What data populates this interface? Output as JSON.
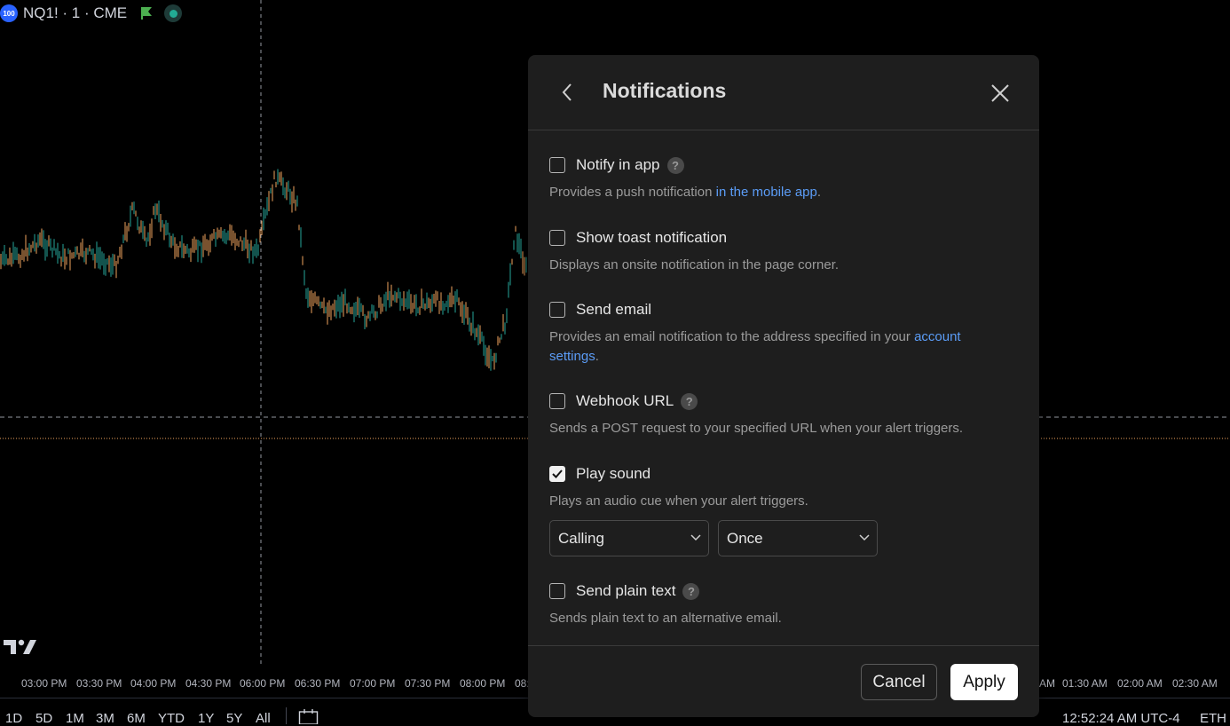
{
  "symbol": {
    "badge": "100",
    "text": "NQ1! · 1 · CME"
  },
  "time_axis": [
    "03:00 PM",
    "03:30 PM",
    "04:00 PM",
    "04:30 PM",
    "06:00 PM",
    "06:30 PM",
    "07:00 PM",
    "07:30 PM",
    "08:00 PM",
    "08:",
    "AM",
    "01:30 AM",
    "02:00 AM",
    "02:30 AM"
  ],
  "ranges": [
    "1D",
    "5D",
    "1M",
    "3M",
    "6M",
    "YTD",
    "1Y",
    "5Y",
    "All"
  ],
  "clock": "12:52:24 AM UTC-4",
  "session": "ETH",
  "dialog": {
    "title": "Notifications",
    "options": [
      {
        "label": "Notify in app",
        "checked": false,
        "help": "?",
        "desc_pre": "Provides a push notification ",
        "desc_link": "in the mobile app",
        "desc_post": "."
      },
      {
        "label": "Show toast notification",
        "checked": false,
        "desc": "Displays an onsite notification in the page corner."
      },
      {
        "label": "Send email",
        "checked": false,
        "desc_pre": "Provides an email notification to the address specified in your ",
        "desc_link": "account settings",
        "desc_post": "."
      },
      {
        "label": "Webhook URL",
        "checked": false,
        "help": "?",
        "desc": "Sends a POST request to your specified URL when your alert triggers."
      },
      {
        "label": "Play sound",
        "checked": true,
        "desc": "Plays an audio cue when your alert triggers."
      },
      {
        "label": "Send plain text",
        "checked": false,
        "help": "?",
        "desc": "Sends plain text to an alternative email."
      }
    ],
    "sound_select": "Calling",
    "repeat_select": "Once",
    "cancel_label": "Cancel",
    "apply_label": "Apply"
  },
  "colors": {
    "up": "#26a69a",
    "down": "#f0a35e",
    "link": "#5b9cf6",
    "dialog_bg": "#1e1e1e"
  }
}
